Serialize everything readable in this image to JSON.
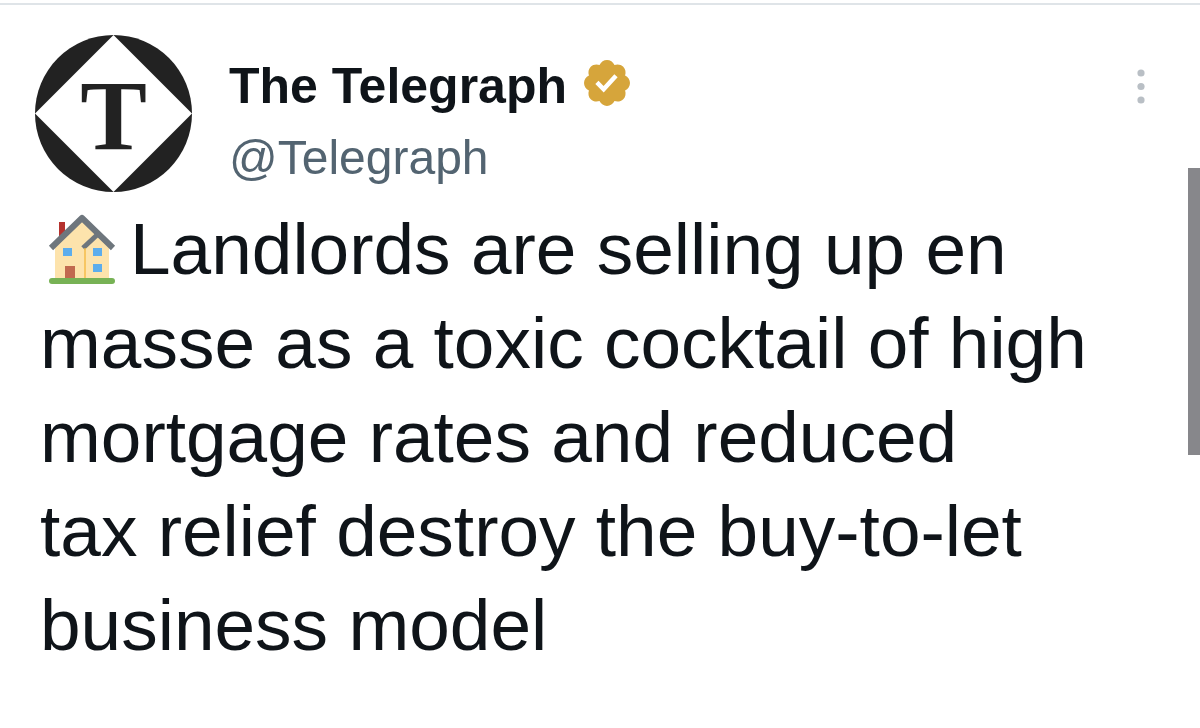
{
  "author": {
    "avatar_letter": "T",
    "name": "The Telegraph",
    "verified": true,
    "handle": "@Telegraph"
  },
  "tweet": {
    "text": "Landlords are selling up en masse as a toxic cocktail of high mortgage rates and reduced tax relief destroy the buy-to-let business model"
  }
}
